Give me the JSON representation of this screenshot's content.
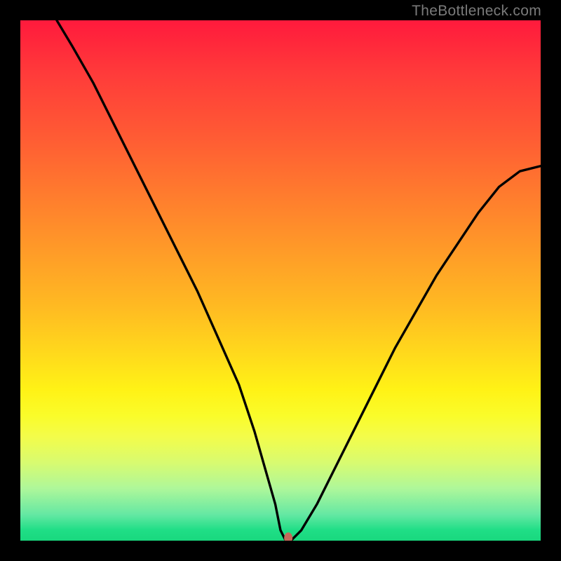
{
  "watermark": "TheBottleneck.com",
  "chart_data": {
    "type": "line",
    "title": "",
    "xlabel": "",
    "ylabel": "",
    "xlim": [
      0,
      100
    ],
    "ylim": [
      0,
      100
    ],
    "series": [
      {
        "name": "bottleneck-curve",
        "x": [
          7,
          10,
          14,
          18,
          22,
          26,
          30,
          34,
          38,
          42,
          45,
          47,
          49,
          50,
          51,
          52,
          54,
          57,
          60,
          64,
          68,
          72,
          76,
          80,
          84,
          88,
          92,
          96,
          100
        ],
        "y": [
          100,
          95,
          88,
          80,
          72,
          64,
          56,
          48,
          39,
          30,
          21,
          14,
          7,
          2,
          0,
          0,
          2,
          7,
          13,
          21,
          29,
          37,
          44,
          51,
          57,
          63,
          68,
          71,
          72
        ]
      }
    ],
    "annotations": [
      {
        "name": "min-marker",
        "x": 51.5,
        "y": 0.5,
        "color": "#c56a5a"
      }
    ],
    "background_gradient": {
      "top": "#ff1a3c",
      "bottom": "#19d87e"
    }
  }
}
